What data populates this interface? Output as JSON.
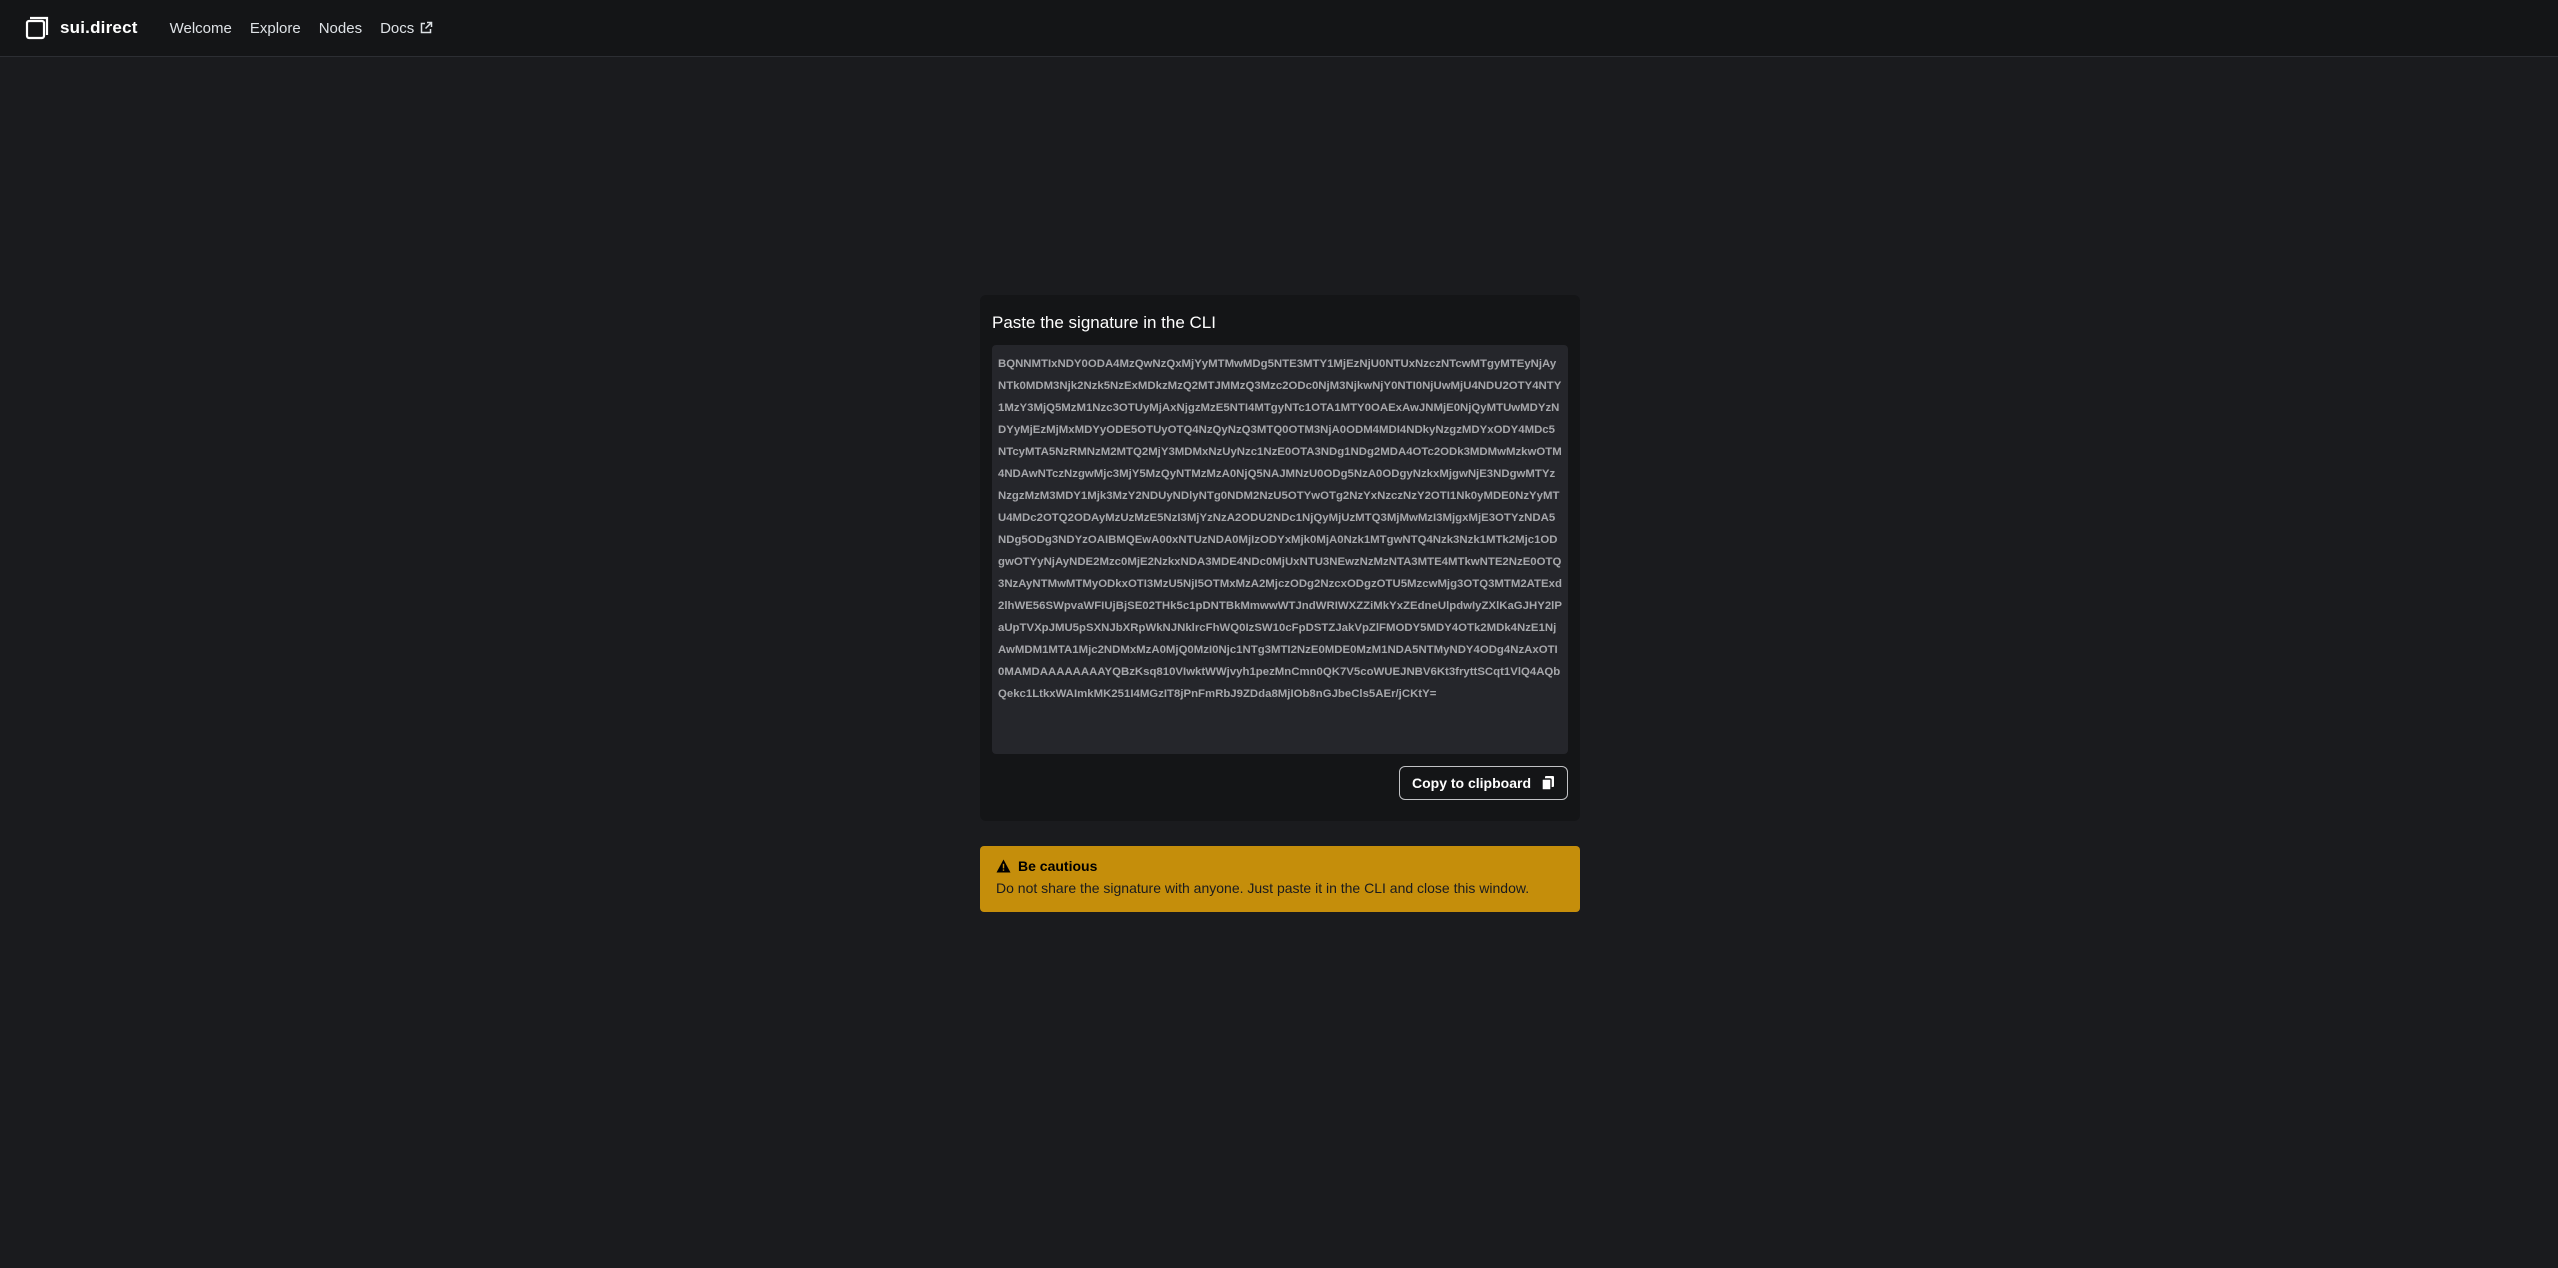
{
  "header": {
    "brand": "sui.direct",
    "nav": [
      {
        "label": "Welcome"
      },
      {
        "label": "Explore"
      },
      {
        "label": "Nodes"
      },
      {
        "label": "Docs"
      }
    ]
  },
  "card": {
    "title": "Paste the signature in the CLI",
    "signature": "BQNNMTIxNDY0ODA4MzQwNzQxMjYyMTMwMDg5NTE3MTY1MjEzNjU0NTUxNzczNTcwMTgyMTEyNjAyNTk0MDM3Njk2Nzk5NzExMDkzMzQ2MTJMMzQ3Mzc2ODc0NjM3NjkwNjY0NTI0NjUwMjU4NDU2OTY4NTY1MzY3MjQ5MzM1Nzc3OTUyMjAxNjgzMzE5NTI4MTgyNTc1OTA1MTY0OAExAwJNMjE0NjQyMTUwMDYzNDYyMjEzMjMxMDYyODE5OTUyOTQ4NzQyNzQ3MTQ0OTM3NjA0ODM4MDI4NDkyNzgzMDYxODY4MDc5NTcyMTA5NzRMNzM2MTQ2MjY3MDMxNzUyNzc1NzE0OTA3NDg1NDg2MDA4OTc2ODk3MDMwMzkwOTM4NDAwNTczNzgwMjc3MjY5MzQyNTMzMzA0NjQ5NAJMNzU0ODg5NzA0ODgyNzkxMjgwNjE3NDgwMTYzNzgzMzM3MDY1Mjk3MzY2NDUyNDlyNTg0NDM2NzU5OTYwOTg2NzYxNzczNzY2OTI1Nk0yMDE0NzYyMTU4MDc2OTQ2ODAyMzUzMzE5NzI3MjYzNzA2ODU2NDc1NjQyMjUzMTQ3MjMwMzI3MjgxMjE3OTYzNDA5NDg5ODg3NDYzOAIBMQEwA00xNTUzNDA0MjIzODYxMjk0MjA0Nzk1MTgwNTQ4Nzk3Nzk1MTk2Mjc1ODgwOTYyNjAyNDE2Mzc0MjE2NzkxNDA3MDE4NDc0MjUxNTU3NEwzNzMzNTA3MTE4MTkwNTE2NzE0OTQ3NzAyNTMwMTMyODkxOTI3MzU5NjI5OTMxMzA2MjczODg2NzcxODgzOTU5MzcwMjg3OTQ3MTM2ATExd2lhWE56SWpvaWFIUjBjSE02THk5c1pDNTBkMmwwWTJndWRIWXZZiMkYxZEdneUlpdwIyZXlKaGJHY2lPaUpTVXpJMU5pSXNJbXRpWkNJNklrcFhWQ0IzSW10cFpDSTZJakVpZlFMODY5MDY4OTk2MDk4NzE1NjAwMDM1MTA1Mjc2NDMxMzA0MjQ0MzI0Njc1NTg3MTI2NzE0MDE0MzM1NDA5NTMyNDY4ODg4NzAxOTI0MAMDAAAAAAAAYQBzKsq810VIwktWWjvyh1pezMnCmn0QK7V5coWUEJNBV6Kt3fryttSCqt1VlQ4AQbQekc1LtkxWAImkMK251I4MGzIT8jPnFmRbJ9ZDda8MjIOb8nGJbeCls5AEr/jCKtY="
  },
  "copy_button": {
    "label": "Copy to clipboard",
    "icon": "clipboard-icon"
  },
  "alert": {
    "title": "Be cautious",
    "message": "Do not share the signature with anyone. Just paste it in the CLI and close this window.",
    "color": "#c58e0b"
  }
}
